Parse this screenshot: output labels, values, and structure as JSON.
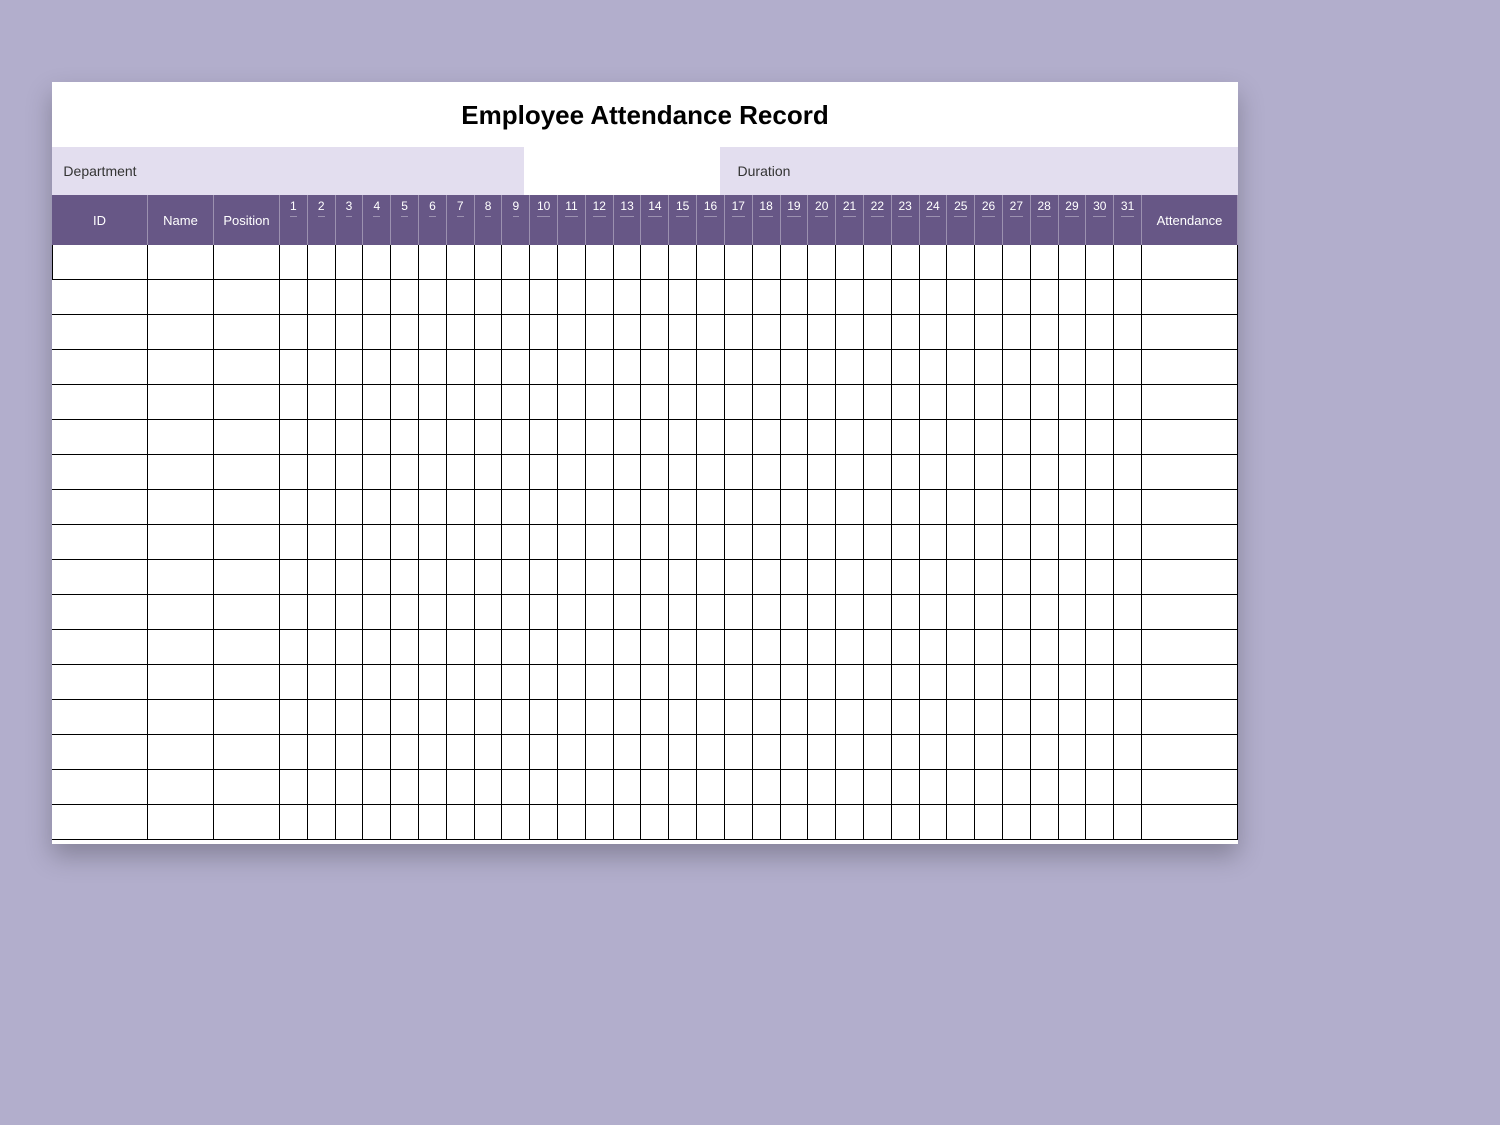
{
  "title": "Employee Attendance Record",
  "filters": {
    "department_label": "Department",
    "department_value": "",
    "duration_label": "Duration",
    "duration_value": ""
  },
  "columns": {
    "id": "ID",
    "name": "Name",
    "position": "Position",
    "days": [
      "1",
      "2",
      "3",
      "4",
      "5",
      "6",
      "7",
      "8",
      "9",
      "10",
      "11",
      "12",
      "13",
      "14",
      "15",
      "16",
      "17",
      "18",
      "19",
      "20",
      "21",
      "22",
      "23",
      "24",
      "25",
      "26",
      "27",
      "28",
      "29",
      "30",
      "31"
    ],
    "attendance": "Attendance"
  },
  "rows": [
    {
      "id": "",
      "name": "",
      "position": "",
      "days": [
        "",
        "",
        "",
        "",
        "",
        "",
        "",
        "",
        "",
        "",
        "",
        "",
        "",
        "",
        "",
        "",
        "",
        "",
        "",
        "",
        "",
        "",
        "",
        "",
        "",
        "",
        "",
        "",
        "",
        "",
        ""
      ],
      "attendance": ""
    },
    {
      "id": "",
      "name": "",
      "position": "",
      "days": [
        "",
        "",
        "",
        "",
        "",
        "",
        "",
        "",
        "",
        "",
        "",
        "",
        "",
        "",
        "",
        "",
        "",
        "",
        "",
        "",
        "",
        "",
        "",
        "",
        "",
        "",
        "",
        "",
        "",
        "",
        ""
      ],
      "attendance": ""
    },
    {
      "id": "",
      "name": "",
      "position": "",
      "days": [
        "",
        "",
        "",
        "",
        "",
        "",
        "",
        "",
        "",
        "",
        "",
        "",
        "",
        "",
        "",
        "",
        "",
        "",
        "",
        "",
        "",
        "",
        "",
        "",
        "",
        "",
        "",
        "",
        "",
        "",
        ""
      ],
      "attendance": ""
    },
    {
      "id": "",
      "name": "",
      "position": "",
      "days": [
        "",
        "",
        "",
        "",
        "",
        "",
        "",
        "",
        "",
        "",
        "",
        "",
        "",
        "",
        "",
        "",
        "",
        "",
        "",
        "",
        "",
        "",
        "",
        "",
        "",
        "",
        "",
        "",
        "",
        "",
        ""
      ],
      "attendance": ""
    },
    {
      "id": "",
      "name": "",
      "position": "",
      "days": [
        "",
        "",
        "",
        "",
        "",
        "",
        "",
        "",
        "",
        "",
        "",
        "",
        "",
        "",
        "",
        "",
        "",
        "",
        "",
        "",
        "",
        "",
        "",
        "",
        "",
        "",
        "",
        "",
        "",
        "",
        ""
      ],
      "attendance": ""
    },
    {
      "id": "",
      "name": "",
      "position": "",
      "days": [
        "",
        "",
        "",
        "",
        "",
        "",
        "",
        "",
        "",
        "",
        "",
        "",
        "",
        "",
        "",
        "",
        "",
        "",
        "",
        "",
        "",
        "",
        "",
        "",
        "",
        "",
        "",
        "",
        "",
        "",
        ""
      ],
      "attendance": ""
    },
    {
      "id": "",
      "name": "",
      "position": "",
      "days": [
        "",
        "",
        "",
        "",
        "",
        "",
        "",
        "",
        "",
        "",
        "",
        "",
        "",
        "",
        "",
        "",
        "",
        "",
        "",
        "",
        "",
        "",
        "",
        "",
        "",
        "",
        "",
        "",
        "",
        "",
        ""
      ],
      "attendance": ""
    },
    {
      "id": "",
      "name": "",
      "position": "",
      "days": [
        "",
        "",
        "",
        "",
        "",
        "",
        "",
        "",
        "",
        "",
        "",
        "",
        "",
        "",
        "",
        "",
        "",
        "",
        "",
        "",
        "",
        "",
        "",
        "",
        "",
        "",
        "",
        "",
        "",
        "",
        ""
      ],
      "attendance": ""
    },
    {
      "id": "",
      "name": "",
      "position": "",
      "days": [
        "",
        "",
        "",
        "",
        "",
        "",
        "",
        "",
        "",
        "",
        "",
        "",
        "",
        "",
        "",
        "",
        "",
        "",
        "",
        "",
        "",
        "",
        "",
        "",
        "",
        "",
        "",
        "",
        "",
        "",
        ""
      ],
      "attendance": ""
    },
    {
      "id": "",
      "name": "",
      "position": "",
      "days": [
        "",
        "",
        "",
        "",
        "",
        "",
        "",
        "",
        "",
        "",
        "",
        "",
        "",
        "",
        "",
        "",
        "",
        "",
        "",
        "",
        "",
        "",
        "",
        "",
        "",
        "",
        "",
        "",
        "",
        "",
        ""
      ],
      "attendance": ""
    },
    {
      "id": "",
      "name": "",
      "position": "",
      "days": [
        "",
        "",
        "",
        "",
        "",
        "",
        "",
        "",
        "",
        "",
        "",
        "",
        "",
        "",
        "",
        "",
        "",
        "",
        "",
        "",
        "",
        "",
        "",
        "",
        "",
        "",
        "",
        "",
        "",
        "",
        ""
      ],
      "attendance": ""
    },
    {
      "id": "",
      "name": "",
      "position": "",
      "days": [
        "",
        "",
        "",
        "",
        "",
        "",
        "",
        "",
        "",
        "",
        "",
        "",
        "",
        "",
        "",
        "",
        "",
        "",
        "",
        "",
        "",
        "",
        "",
        "",
        "",
        "",
        "",
        "",
        "",
        "",
        ""
      ],
      "attendance": ""
    },
    {
      "id": "",
      "name": "",
      "position": "",
      "days": [
        "",
        "",
        "",
        "",
        "",
        "",
        "",
        "",
        "",
        "",
        "",
        "",
        "",
        "",
        "",
        "",
        "",
        "",
        "",
        "",
        "",
        "",
        "",
        "",
        "",
        "",
        "",
        "",
        "",
        "",
        ""
      ],
      "attendance": ""
    },
    {
      "id": "",
      "name": "",
      "position": "",
      "days": [
        "",
        "",
        "",
        "",
        "",
        "",
        "",
        "",
        "",
        "",
        "",
        "",
        "",
        "",
        "",
        "",
        "",
        "",
        "",
        "",
        "",
        "",
        "",
        "",
        "",
        "",
        "",
        "",
        "",
        "",
        ""
      ],
      "attendance": ""
    },
    {
      "id": "",
      "name": "",
      "position": "",
      "days": [
        "",
        "",
        "",
        "",
        "",
        "",
        "",
        "",
        "",
        "",
        "",
        "",
        "",
        "",
        "",
        "",
        "",
        "",
        "",
        "",
        "",
        "",
        "",
        "",
        "",
        "",
        "",
        "",
        "",
        "",
        ""
      ],
      "attendance": ""
    },
    {
      "id": "",
      "name": "",
      "position": "",
      "days": [
        "",
        "",
        "",
        "",
        "",
        "",
        "",
        "",
        "",
        "",
        "",
        "",
        "",
        "",
        "",
        "",
        "",
        "",
        "",
        "",
        "",
        "",
        "",
        "",
        "",
        "",
        "",
        "",
        "",
        "",
        ""
      ],
      "attendance": ""
    },
    {
      "id": "",
      "name": "",
      "position": "",
      "days": [
        "",
        "",
        "",
        "",
        "",
        "",
        "",
        "",
        "",
        "",
        "",
        "",
        "",
        "",
        "",
        "",
        "",
        "",
        "",
        "",
        "",
        "",
        "",
        "",
        "",
        "",
        "",
        "",
        "",
        "",
        ""
      ],
      "attendance": ""
    }
  ]
}
